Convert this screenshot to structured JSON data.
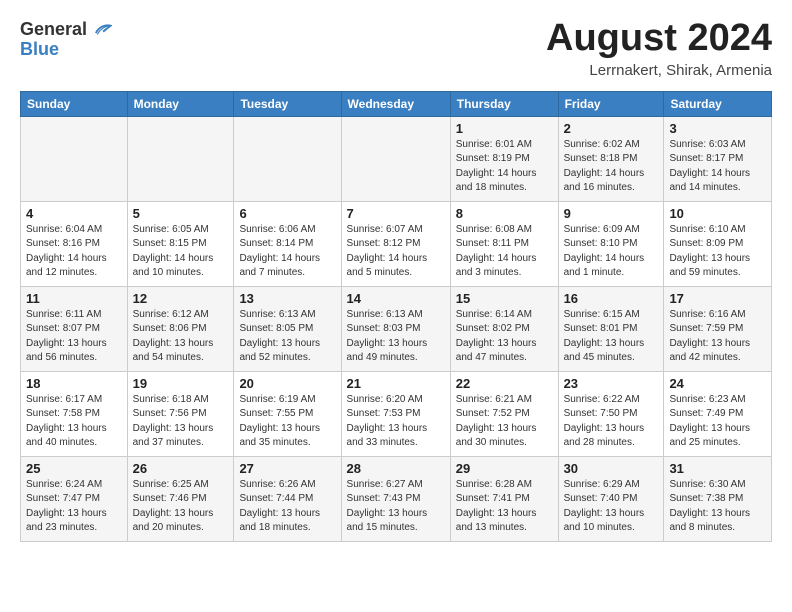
{
  "header": {
    "logo_general": "General",
    "logo_blue": "Blue",
    "title": "August 2024",
    "location": "Lerrnakert, Shirak, Armenia"
  },
  "calendar": {
    "days_of_week": [
      "Sunday",
      "Monday",
      "Tuesday",
      "Wednesday",
      "Thursday",
      "Friday",
      "Saturday"
    ],
    "weeks": [
      [
        {
          "day": "",
          "info": ""
        },
        {
          "day": "",
          "info": ""
        },
        {
          "day": "",
          "info": ""
        },
        {
          "day": "",
          "info": ""
        },
        {
          "day": "1",
          "info": "Sunrise: 6:01 AM\nSunset: 8:19 PM\nDaylight: 14 hours\nand 18 minutes."
        },
        {
          "day": "2",
          "info": "Sunrise: 6:02 AM\nSunset: 8:18 PM\nDaylight: 14 hours\nand 16 minutes."
        },
        {
          "day": "3",
          "info": "Sunrise: 6:03 AM\nSunset: 8:17 PM\nDaylight: 14 hours\nand 14 minutes."
        }
      ],
      [
        {
          "day": "4",
          "info": "Sunrise: 6:04 AM\nSunset: 8:16 PM\nDaylight: 14 hours\nand 12 minutes."
        },
        {
          "day": "5",
          "info": "Sunrise: 6:05 AM\nSunset: 8:15 PM\nDaylight: 14 hours\nand 10 minutes."
        },
        {
          "day": "6",
          "info": "Sunrise: 6:06 AM\nSunset: 8:14 PM\nDaylight: 14 hours\nand 7 minutes."
        },
        {
          "day": "7",
          "info": "Sunrise: 6:07 AM\nSunset: 8:12 PM\nDaylight: 14 hours\nand 5 minutes."
        },
        {
          "day": "8",
          "info": "Sunrise: 6:08 AM\nSunset: 8:11 PM\nDaylight: 14 hours\nand 3 minutes."
        },
        {
          "day": "9",
          "info": "Sunrise: 6:09 AM\nSunset: 8:10 PM\nDaylight: 14 hours\nand 1 minute."
        },
        {
          "day": "10",
          "info": "Sunrise: 6:10 AM\nSunset: 8:09 PM\nDaylight: 13 hours\nand 59 minutes."
        }
      ],
      [
        {
          "day": "11",
          "info": "Sunrise: 6:11 AM\nSunset: 8:07 PM\nDaylight: 13 hours\nand 56 minutes."
        },
        {
          "day": "12",
          "info": "Sunrise: 6:12 AM\nSunset: 8:06 PM\nDaylight: 13 hours\nand 54 minutes."
        },
        {
          "day": "13",
          "info": "Sunrise: 6:13 AM\nSunset: 8:05 PM\nDaylight: 13 hours\nand 52 minutes."
        },
        {
          "day": "14",
          "info": "Sunrise: 6:13 AM\nSunset: 8:03 PM\nDaylight: 13 hours\nand 49 minutes."
        },
        {
          "day": "15",
          "info": "Sunrise: 6:14 AM\nSunset: 8:02 PM\nDaylight: 13 hours\nand 47 minutes."
        },
        {
          "day": "16",
          "info": "Sunrise: 6:15 AM\nSunset: 8:01 PM\nDaylight: 13 hours\nand 45 minutes."
        },
        {
          "day": "17",
          "info": "Sunrise: 6:16 AM\nSunset: 7:59 PM\nDaylight: 13 hours\nand 42 minutes."
        }
      ],
      [
        {
          "day": "18",
          "info": "Sunrise: 6:17 AM\nSunset: 7:58 PM\nDaylight: 13 hours\nand 40 minutes."
        },
        {
          "day": "19",
          "info": "Sunrise: 6:18 AM\nSunset: 7:56 PM\nDaylight: 13 hours\nand 37 minutes."
        },
        {
          "day": "20",
          "info": "Sunrise: 6:19 AM\nSunset: 7:55 PM\nDaylight: 13 hours\nand 35 minutes."
        },
        {
          "day": "21",
          "info": "Sunrise: 6:20 AM\nSunset: 7:53 PM\nDaylight: 13 hours\nand 33 minutes."
        },
        {
          "day": "22",
          "info": "Sunrise: 6:21 AM\nSunset: 7:52 PM\nDaylight: 13 hours\nand 30 minutes."
        },
        {
          "day": "23",
          "info": "Sunrise: 6:22 AM\nSunset: 7:50 PM\nDaylight: 13 hours\nand 28 minutes."
        },
        {
          "day": "24",
          "info": "Sunrise: 6:23 AM\nSunset: 7:49 PM\nDaylight: 13 hours\nand 25 minutes."
        }
      ],
      [
        {
          "day": "25",
          "info": "Sunrise: 6:24 AM\nSunset: 7:47 PM\nDaylight: 13 hours\nand 23 minutes."
        },
        {
          "day": "26",
          "info": "Sunrise: 6:25 AM\nSunset: 7:46 PM\nDaylight: 13 hours\nand 20 minutes."
        },
        {
          "day": "27",
          "info": "Sunrise: 6:26 AM\nSunset: 7:44 PM\nDaylight: 13 hours\nand 18 minutes."
        },
        {
          "day": "28",
          "info": "Sunrise: 6:27 AM\nSunset: 7:43 PM\nDaylight: 13 hours\nand 15 minutes."
        },
        {
          "day": "29",
          "info": "Sunrise: 6:28 AM\nSunset: 7:41 PM\nDaylight: 13 hours\nand 13 minutes."
        },
        {
          "day": "30",
          "info": "Sunrise: 6:29 AM\nSunset: 7:40 PM\nDaylight: 13 hours\nand 10 minutes."
        },
        {
          "day": "31",
          "info": "Sunrise: 6:30 AM\nSunset: 7:38 PM\nDaylight: 13 hours\nand 8 minutes."
        }
      ]
    ]
  }
}
